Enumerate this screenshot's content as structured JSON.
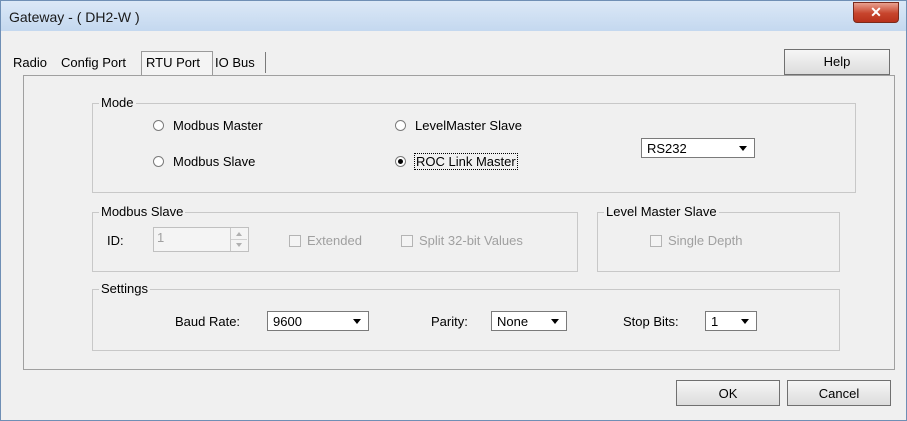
{
  "window": {
    "title": "Gateway - ( DH2-W )"
  },
  "tabs": [
    {
      "label": "Radio"
    },
    {
      "label": "Config Port"
    },
    {
      "label": "RTU Port"
    },
    {
      "label": "IO Bus"
    }
  ],
  "help_label": "Help",
  "mode": {
    "title": "Mode",
    "options": {
      "modbus_master": "Modbus Master",
      "modbus_slave": "Modbus Slave",
      "levelmaster_slave": "LevelMaster Slave",
      "roc_link_master": "ROC Link Master"
    },
    "selected": "ROC Link Master",
    "interface": "RS232"
  },
  "modbus_slave": {
    "title": "Modbus Slave",
    "id_label": "ID:",
    "id_value": "1",
    "extended_label": "Extended",
    "split_label": "Split 32-bit Values"
  },
  "level_master_slave": {
    "title": "Level Master Slave",
    "single_depth_label": "Single Depth"
  },
  "settings": {
    "title": "Settings",
    "baud_label": "Baud Rate:",
    "baud_value": "9600",
    "parity_label": "Parity:",
    "parity_value": "None",
    "stop_label": "Stop Bits:",
    "stop_value": "1"
  },
  "buttons": {
    "ok": "OK",
    "cancel": "Cancel"
  }
}
